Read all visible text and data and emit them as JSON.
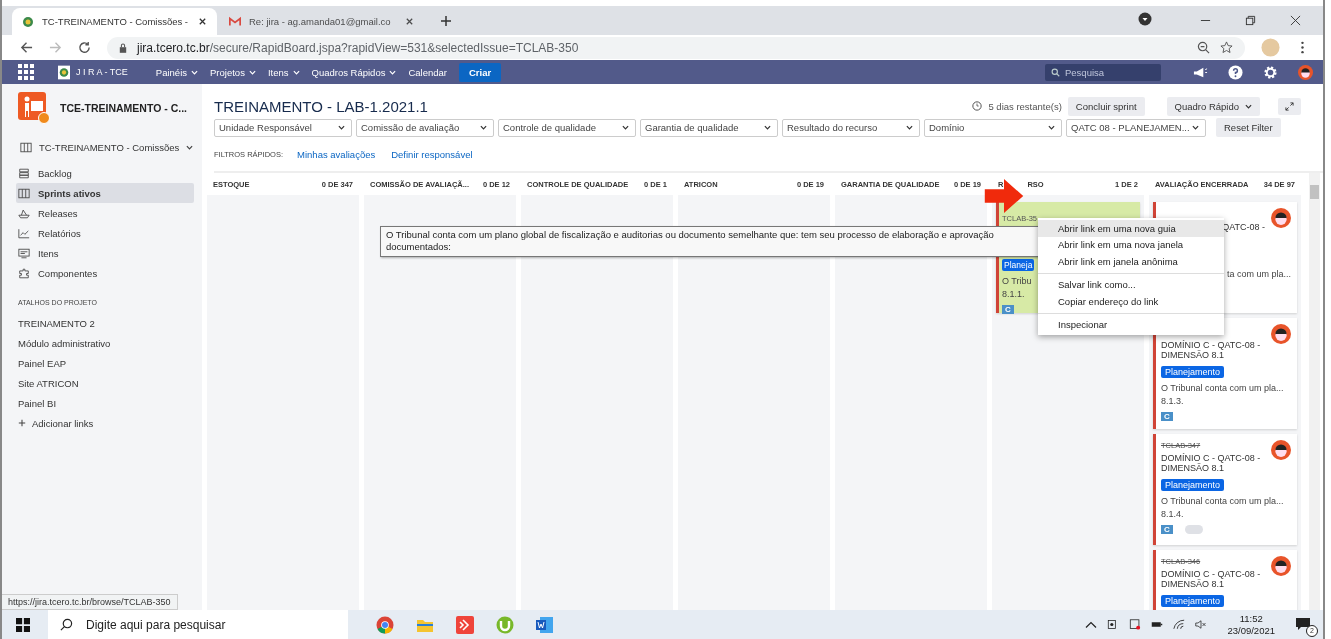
{
  "browser": {
    "tabs": [
      {
        "title": "TC-TREINAMENTO - Comissões -",
        "selected": true
      },
      {
        "title": "Re: jira - ag.amanda01@gmail.co",
        "selected": false
      }
    ],
    "url_host": "jira.tcero.tc.br",
    "url_path": "/secure/RapidBoard.jspa?rapidView=531&selectedIssue=TCLAB-350"
  },
  "nav": {
    "logo": "J I R A - TCE",
    "menus": [
      {
        "label": "Painéis",
        "dropdown": true
      },
      {
        "label": "Projetos",
        "dropdown": true
      },
      {
        "label": "Itens",
        "dropdown": true
      },
      {
        "label": "Quadros Rápidos",
        "dropdown": true
      },
      {
        "label": "Calendar",
        "dropdown": false
      }
    ],
    "create": "Criar",
    "search_placeholder": "Pesquisa"
  },
  "sidebar": {
    "project": "TCE-TREINAMENTO - C...",
    "board": "TC-TREINAMENTO - Comissões",
    "items": [
      {
        "label": "Backlog",
        "kind": "backlog",
        "selected": false
      },
      {
        "label": "Sprints ativos",
        "kind": "board",
        "selected": true
      },
      {
        "label": "Releases",
        "kind": "releases",
        "selected": false
      },
      {
        "label": "Relatórios",
        "kind": "reports",
        "selected": false
      },
      {
        "label": "Itens",
        "kind": "issues",
        "selected": false
      },
      {
        "label": "Componentes",
        "kind": "components",
        "selected": false
      }
    ],
    "shortcuts_heading": "ATALHOS DO PROJETO",
    "shortcuts": [
      "TREINAMENTO 2",
      "Módulo administrativo",
      "Painel EAP",
      "Site ATRICON",
      "Painel BI"
    ],
    "add_link": "Adicionar links"
  },
  "board": {
    "title": "TREINAMENTO - LAB-1.2021.1",
    "remaining": "5 dias restante(s)",
    "complete_button": "Concluir sprint",
    "quick_board": "Quadro Rápido",
    "filters": [
      "Unidade Responsável",
      "Comissão de avaliação",
      "Controle de qualidade",
      "Garantia de qualidade",
      "Resultado do recurso",
      "Domínio",
      "QATC 08 - PLANEJAMEN..."
    ],
    "reset": "Reset Filter",
    "quick_filters_label": "FILTROS RÁPIDOS:",
    "quick_filters": [
      "Minhas avaliações",
      "Definir responsável"
    ],
    "columns": [
      {
        "name": "ESTOQUE",
        "count": "0 DE 347"
      },
      {
        "name": "COMISSÃO DE AVALIAÇÃ...",
        "count": "0 DE 12"
      },
      {
        "name": "CONTROLE DE QUALIDADE",
        "count": "0 DE 1"
      },
      {
        "name": "ATRICON",
        "count": "0 DE 19"
      },
      {
        "name": "GARANTIA DE QUALIDADE",
        "count": "0 DE 19"
      },
      {
        "name": "R",
        "name_rest": "RSO",
        "count": "1 DE 2",
        "cards": [
          {
            "kind": "covered",
            "selected": true,
            "key": "TCLAB-35",
            "tag": "Planeja",
            "summary": "O Tribu",
            "number": "8.1.1.",
            "type": "C"
          }
        ]
      },
      {
        "name": "AVALIAÇÃO ENCERRADA",
        "count": "34 DE 97",
        "cards": [
          {
            "kind": "partial",
            "selected": false,
            "title": "QATC-08 -",
            "summary": "ta com um pla...",
            "avatar": true
          },
          {
            "kind": "lowered",
            "selected": false,
            "title": "DOMÍNIO C - QATC-08 - DIMENSÃO 8.1",
            "tag": "Planejamento",
            "summary": "O Tribunal conta com um pla...",
            "number": "8.1.3.",
            "type": "C",
            "avatar": true
          },
          {
            "kind": "full",
            "selected": false,
            "key": "TCLAB-347",
            "done": true,
            "title": "DOMÍNIO C - QATC-08 - DIMENSÃO 8.1",
            "tag": "Planejamento",
            "summary": "O Tribunal conta com um pla...",
            "number": "8.1.4.",
            "type": "C",
            "avatar": true
          },
          {
            "kind": "full",
            "selected": false,
            "key": "TCLAB-346",
            "done": true,
            "title": "DOMÍNIO C - QATC-08 - DIMENSÃO 8.1",
            "tag": "Planejamento",
            "avatar": true
          }
        ]
      }
    ]
  },
  "tooltip": "O Tribunal conta com um plano global de fiscalização e auditorias ou documento semelhante que: tem seu processo de elaboração e aprovação documentados:",
  "context_menu": [
    {
      "items": [
        {
          "label": "Abrir link em uma nova guia",
          "selected": true
        },
        {
          "label": "Abrir link em uma nova janela",
          "selected": false
        },
        {
          "label": "Abrir link em janela anônima",
          "selected": false
        }
      ]
    },
    {
      "items": [
        {
          "label": "Salvar link como...",
          "selected": false
        },
        {
          "label": "Copiar endereço do link",
          "selected": false
        }
      ]
    },
    {
      "items": [
        {
          "label": "Inspecionar",
          "selected": false
        }
      ]
    }
  ],
  "status_url": "https://jira.tcero.tc.br/browse/TCLAB-350",
  "taskbar": {
    "search_placeholder": "Digite aqui para pesquisar",
    "time": "11:52",
    "date": "23/09/2021",
    "notifications": "2"
  }
}
